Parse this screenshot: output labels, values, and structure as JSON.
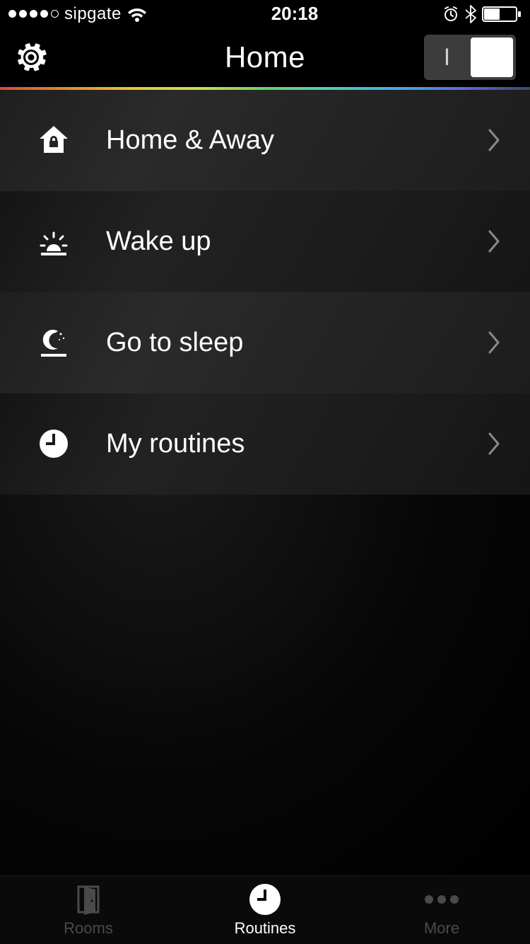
{
  "status_bar": {
    "carrier": "sipgate",
    "time": "20:18"
  },
  "nav": {
    "title": "Home",
    "toggle_off_glyph": "I"
  },
  "routines": [
    {
      "label": "Home & Away",
      "icon": "home-lock-icon"
    },
    {
      "label": "Wake up",
      "icon": "sunrise-icon"
    },
    {
      "label": "Go to sleep",
      "icon": "moon-icon"
    },
    {
      "label": "My routines",
      "icon": "clock-icon"
    }
  ],
  "tabs": {
    "rooms": "Rooms",
    "routines": "Routines",
    "more": "More"
  }
}
